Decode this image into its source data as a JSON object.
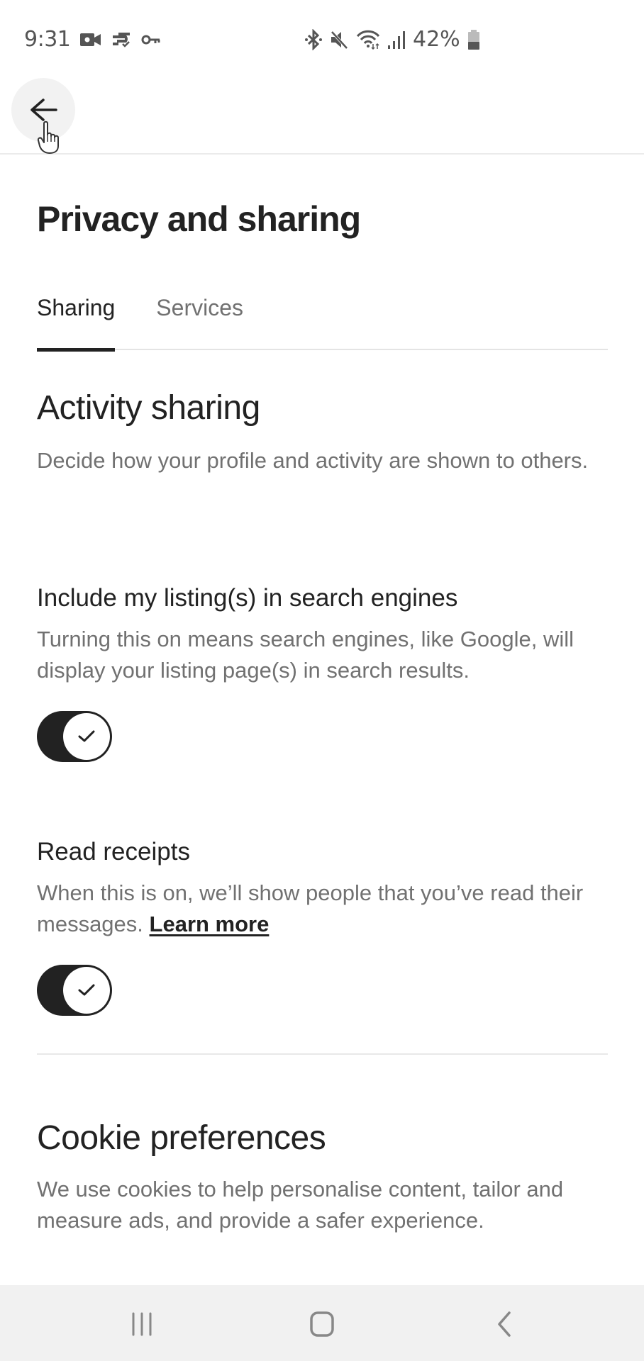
{
  "status_bar": {
    "time": "9:31",
    "left_icons": [
      "video-camera-icon",
      "sync-check-icon",
      "vpn-key-icon"
    ],
    "right_icons": [
      "bluetooth-icon",
      "mute-icon",
      "wifi-icon",
      "signal-icon"
    ],
    "battery_percent": "42%",
    "battery_level": 0.42
  },
  "header": {
    "back_label": "Back"
  },
  "page": {
    "title": "Privacy and sharing",
    "tabs": [
      {
        "label": "Sharing",
        "active": true
      },
      {
        "label": "Services",
        "active": false
      }
    ]
  },
  "activity_sharing": {
    "title": "Activity sharing",
    "description": "Decide how your profile and activity are shown to others.",
    "settings": [
      {
        "title": "Include my listing(s) in search engines",
        "description": "Turning this on means search engines, like Google, will display your listing page(s) in search results.",
        "enabled": true
      },
      {
        "title": "Read receipts",
        "description": "When this is on, we’ll show people that you’ve read their messages.",
        "link_label": "Learn more",
        "enabled": true
      }
    ]
  },
  "cookie_preferences": {
    "title": "Cookie preferences",
    "description": "We use cookies to help personalise content, tailor and measure ads, and provide a safer experience."
  },
  "nav_bar": {
    "buttons": [
      "recent-apps",
      "home",
      "back"
    ]
  },
  "colors": {
    "text_primary": "#222222",
    "text_secondary": "#717171",
    "toggle_on": "#222222",
    "divider": "#e8e8e8",
    "nav_bar_bg": "#f1f1f1"
  }
}
